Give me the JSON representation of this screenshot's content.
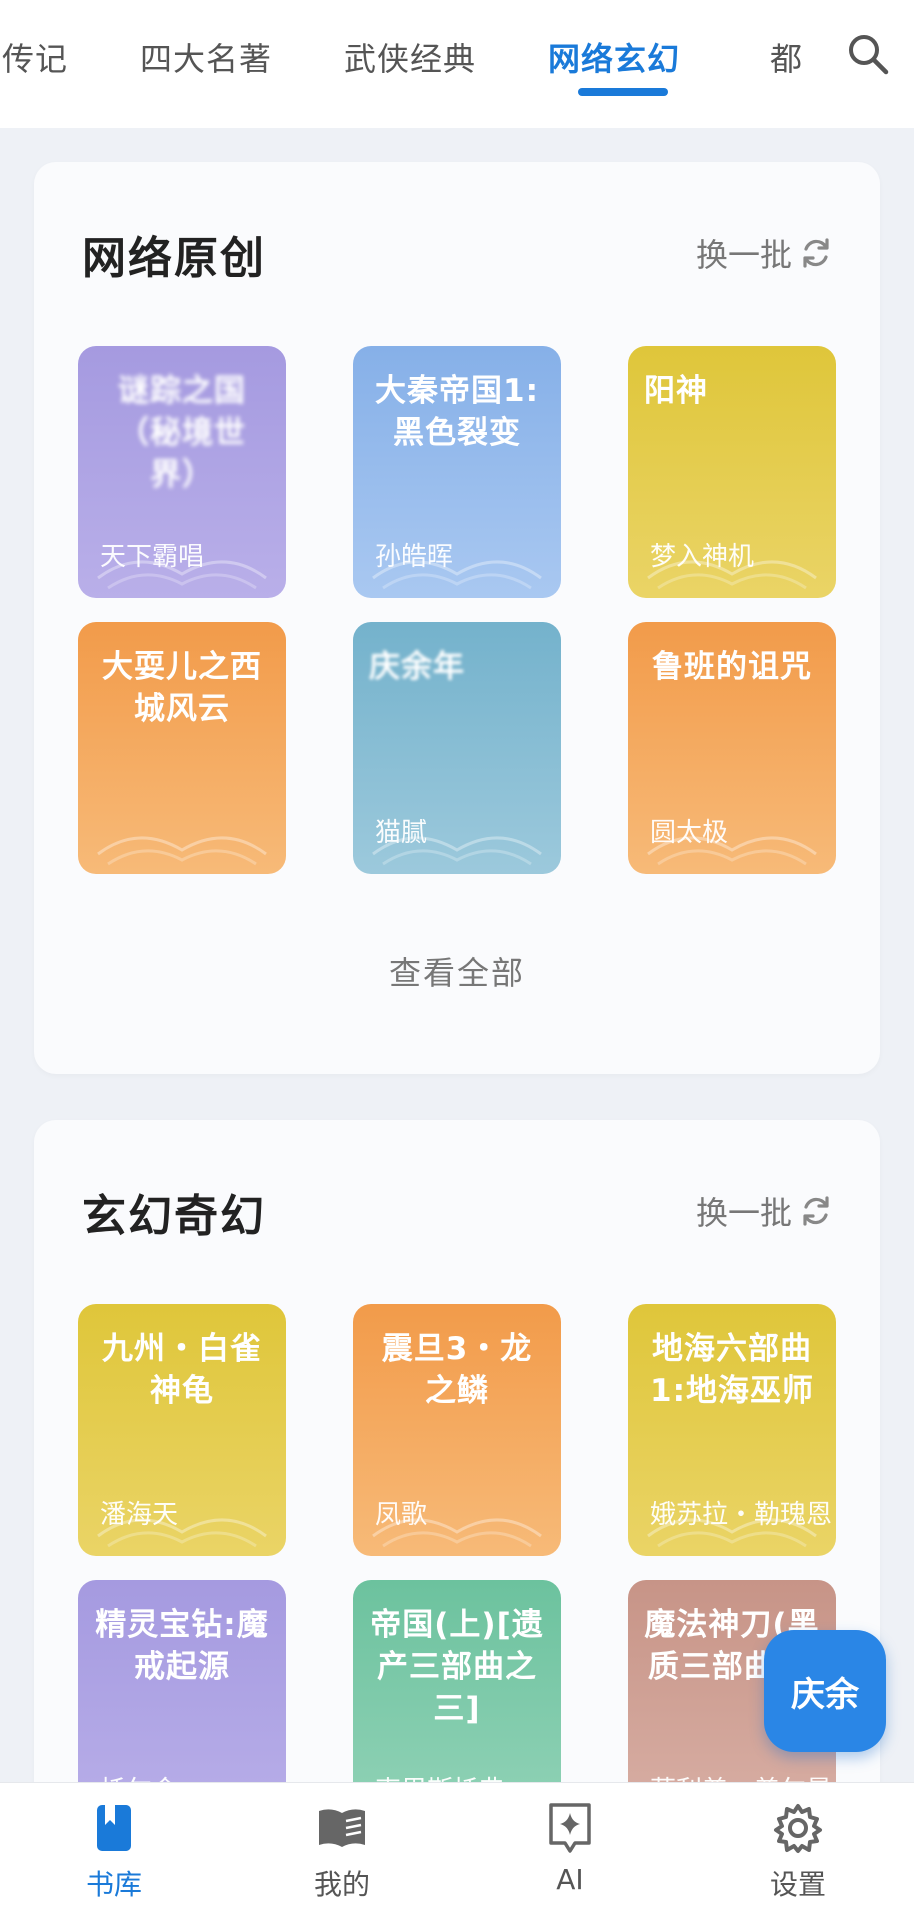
{
  "tabs": {
    "items": [
      "传记",
      "四大名著",
      "武侠经典",
      "网络玄幻",
      "都"
    ],
    "active_index": 3
  },
  "sections": [
    {
      "title": "网络原创",
      "refresh_label": "换一批",
      "view_all_label": "查看全部",
      "books": [
        {
          "title": "谜踪之国（秘境世界）",
          "author": "天下霸唱",
          "color": "purple"
        },
        {
          "title": "大秦帝国1:黑色裂变",
          "author": "孙皓晖",
          "color": "blue"
        },
        {
          "title": "阳神",
          "author": "梦入神机",
          "color": "yellow"
        },
        {
          "title": "大耍儿之西城风云",
          "author": "",
          "color": "orange"
        },
        {
          "title": "庆余年",
          "author": "猫腻",
          "color": "teal"
        },
        {
          "title": "鲁班的诅咒",
          "author": "圆太极",
          "color": "orange"
        }
      ]
    },
    {
      "title": "玄幻奇幻",
      "refresh_label": "换一批",
      "books": [
        {
          "title": "九州・白雀神龟",
          "author": "潘海天",
          "color": "yellow"
        },
        {
          "title": "震旦3・龙之鳞",
          "author": "凤歌",
          "color": "orange"
        },
        {
          "title": "地海六部曲1:地海巫师",
          "author": "娥苏拉・勒瑰恩",
          "color": "yellow"
        },
        {
          "title": "精灵宝钻:魔戒起源",
          "author": "托尔金",
          "color": "purple"
        },
        {
          "title": "帝国(上)[遗产三部曲之三]",
          "author": "克里斯托弗",
          "color": "green"
        },
        {
          "title": "魔法神刀(黑质三部曲II)",
          "author": "菲利普・普尔曼",
          "color": "brown"
        }
      ]
    }
  ],
  "fab_label": "庆余",
  "bottom_nav": [
    {
      "label": "书库",
      "icon": "bookmark-book-icon",
      "active": true
    },
    {
      "label": "我的",
      "icon": "open-book-icon",
      "active": false
    },
    {
      "label": "AI",
      "icon": "ai-sparkle-icon",
      "active": false
    },
    {
      "label": "设置",
      "icon": "gear-icon",
      "active": false
    }
  ],
  "colors": {
    "accent": "#1a7ad9",
    "fab": "#2a86e6"
  }
}
